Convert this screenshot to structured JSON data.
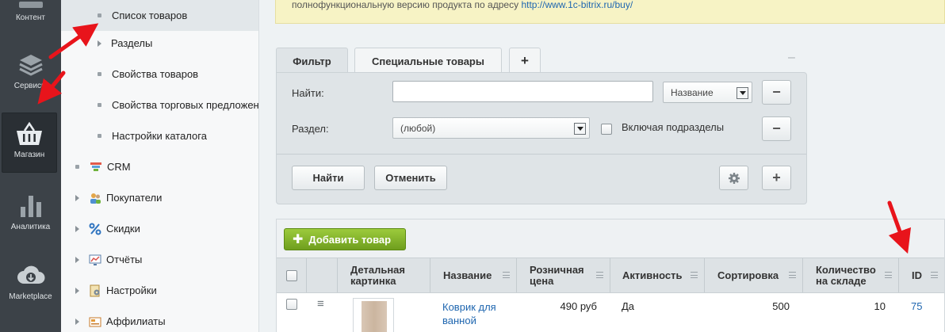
{
  "rail": {
    "items": [
      {
        "label": "Контент",
        "icon": "content-icon"
      },
      {
        "label": "Сервисы",
        "icon": "layers-icon"
      },
      {
        "label": "Магазин",
        "icon": "basket-icon",
        "active": true
      },
      {
        "label": "Аналитика",
        "icon": "bar-chart-icon"
      },
      {
        "label": "Marketplace",
        "icon": "cloud-download-icon"
      }
    ]
  },
  "menu": {
    "items": [
      {
        "label": "Список товаров",
        "marker": "bullet",
        "selected": true
      },
      {
        "label": "Разделы",
        "marker": "arrow"
      },
      {
        "label": "Свойства товаров",
        "marker": "bullet"
      },
      {
        "label": "Свойства торговых предложен",
        "marker": "bullet"
      },
      {
        "label": "Настройки каталога",
        "marker": "bullet"
      },
      {
        "label": "CRM",
        "marker": "bullet",
        "icon": "crm-funnel-icon"
      },
      {
        "label": "Покупатели",
        "marker": "arrow",
        "icon": "users-icon"
      },
      {
        "label": "Скидки",
        "marker": "arrow",
        "icon": "percent-icon"
      },
      {
        "label": "Отчёты",
        "marker": "arrow",
        "icon": "report-icon"
      },
      {
        "label": "Настройки",
        "marker": "arrow",
        "icon": "settings-doc-icon"
      },
      {
        "label": "Аффилиаты",
        "marker": "arrow",
        "icon": "affiliates-icon"
      }
    ]
  },
  "notice": {
    "text": "полнофункциональную версию продукта по адресу",
    "link": "http://www.1c-bitrix.ru/buy/"
  },
  "filter": {
    "tabs": [
      "Фильтр",
      "Специальные товары",
      "+"
    ],
    "collapse_glyph": "–",
    "find_label": "Найти:",
    "find_value": "",
    "find_field_option": "Название",
    "section_label": "Раздел:",
    "section_value": "(любой)",
    "include_subsections_label": "Включая подразделы",
    "remove_glyph": "−",
    "find_button": "Найти",
    "cancel_button": "Отменить",
    "add_glyph": "+"
  },
  "grid": {
    "add_button": "Добавить товар",
    "columns": [
      "Детальная картинка",
      "Название",
      "Розничная цена",
      "Активность",
      "Сортировка",
      "Количество на складе",
      "ID"
    ],
    "rows": [
      {
        "name": "Коврик для ванной",
        "price": "490 руб",
        "active": "Да",
        "sort": "500",
        "qty": "10",
        "id": "75"
      }
    ]
  },
  "colors": {
    "rail_bg": "#3c4248",
    "accent_green": "#7fb22b",
    "link_blue": "#2067b0",
    "annotation_red": "#e8141b"
  }
}
